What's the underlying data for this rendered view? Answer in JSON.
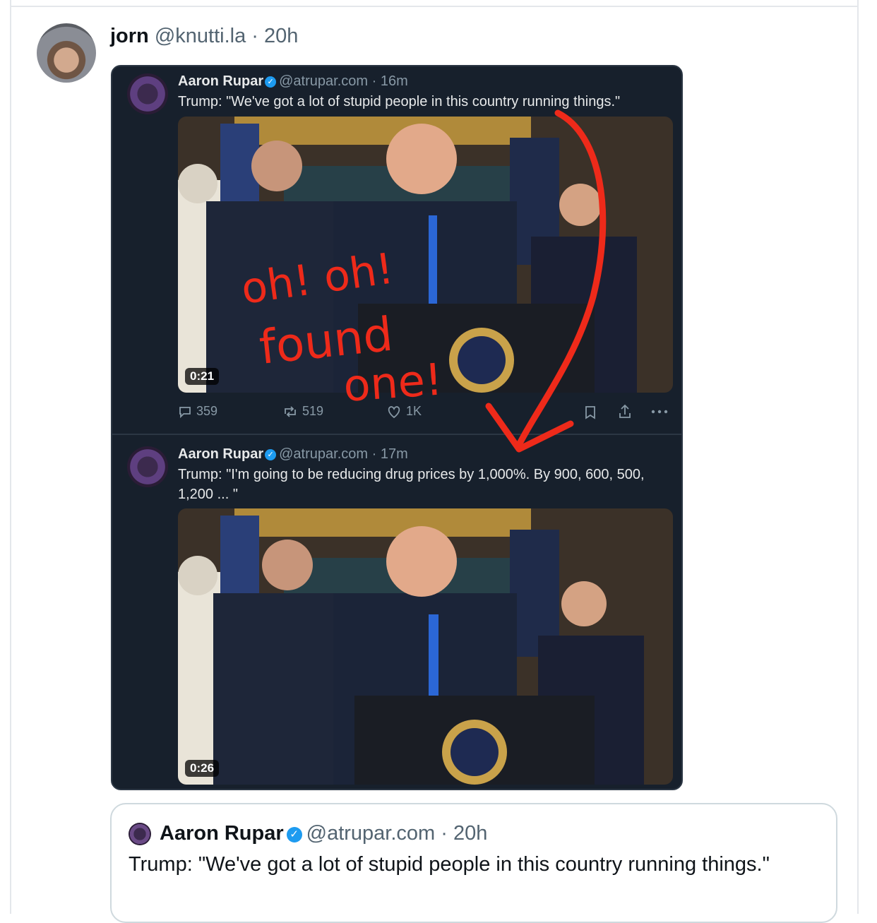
{
  "post": {
    "author_name": "jorn",
    "author_handle": "@knutti.la",
    "separator": "·",
    "time": "20h"
  },
  "embedded": {
    "tweet1": {
      "name": "Aaron Rupar",
      "handle": "@atrupar.com",
      "separator": "·",
      "time": "16m",
      "text": "Trump: \"We've got a lot of stupid people in this country running things.\"",
      "duration": "0:21",
      "replies": "359",
      "reposts": "519",
      "likes": "1K"
    },
    "tweet2": {
      "name": "Aaron Rupar",
      "handle": "@atrupar.com",
      "separator": "·",
      "time": "17m",
      "text": "Trump: \"I'm going to be reducing drug prices by 1,000%. By 900, 600, 500, 1,200 ... \"",
      "duration": "0:26"
    },
    "annotation": {
      "line1": "oh! oh!",
      "line2": "found",
      "line3": "one!",
      "color": "#ee2a1a"
    }
  },
  "quote": {
    "name": "Aaron Rupar",
    "handle": "@atrupar.com",
    "separator": "·",
    "time": "20h",
    "text": "Trump: \"We've got a lot of stupid people in this country running things.\""
  },
  "icons": [
    "verified-badge-icon",
    "reply-icon",
    "repost-icon",
    "like-icon",
    "bookmark-icon",
    "share-icon",
    "more-icon"
  ]
}
